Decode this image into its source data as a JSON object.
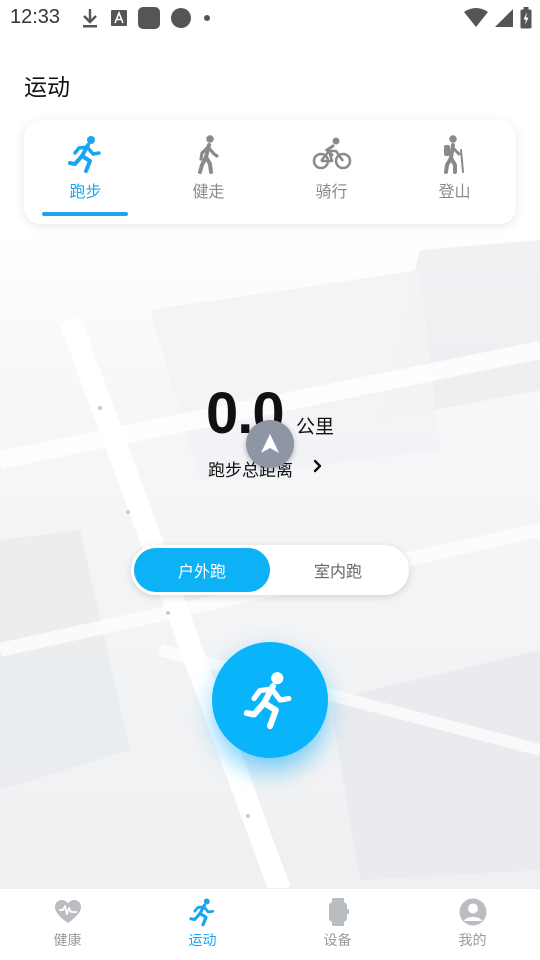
{
  "status_bar": {
    "time": "12:33"
  },
  "page": {
    "title": "运动"
  },
  "sport_tabs": [
    {
      "label": "跑步",
      "icon": "running-icon",
      "active": true
    },
    {
      "label": "健走",
      "icon": "walking-icon",
      "active": false
    },
    {
      "label": "骑行",
      "icon": "cycling-icon",
      "active": false
    },
    {
      "label": "登山",
      "icon": "hiking-icon",
      "active": false
    }
  ],
  "distance": {
    "value": "0.0",
    "unit": "公里",
    "caption": "跑步总距离"
  },
  "mode_toggle": {
    "outdoor_label": "户外跑",
    "indoor_label": "室内跑",
    "selected": "outdoor"
  },
  "bottom_nav": [
    {
      "label": "健康",
      "icon": "heart-icon",
      "active": false
    },
    {
      "label": "运动",
      "icon": "running-icon",
      "active": true
    },
    {
      "label": "设备",
      "icon": "watch-icon",
      "active": false
    },
    {
      "label": "我的",
      "icon": "profile-icon",
      "active": false
    }
  ],
  "colors": {
    "accent": "#1aa6ef",
    "start_button": "#0ab4fa",
    "inactive": "#9a9a9a"
  }
}
